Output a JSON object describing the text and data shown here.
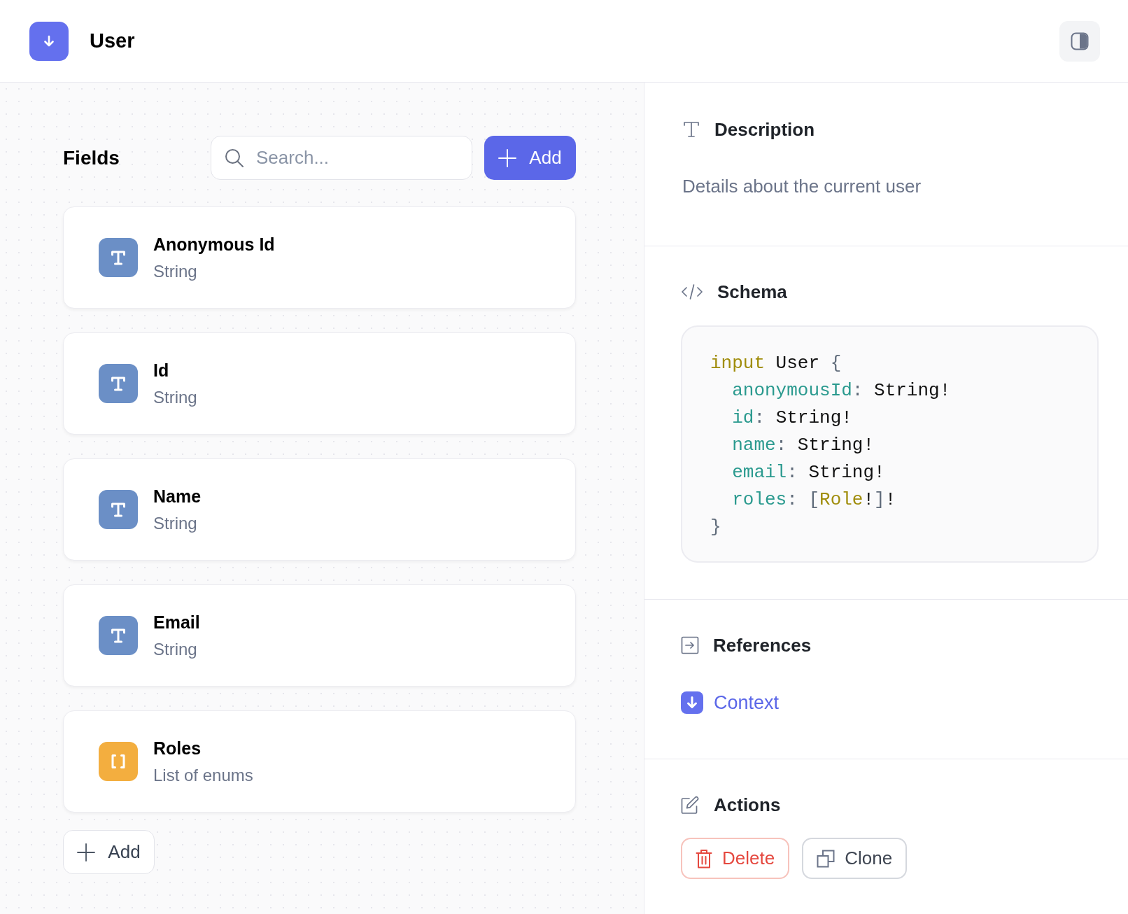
{
  "header": {
    "title": "User"
  },
  "fields_panel": {
    "title": "Fields",
    "search": {
      "placeholder": "Search..."
    },
    "add_button": "Add",
    "fields": [
      {
        "name": "Anonymous Id",
        "type": "String",
        "kind": "text"
      },
      {
        "name": "Id",
        "type": "String",
        "kind": "text"
      },
      {
        "name": "Name",
        "type": "String",
        "kind": "text"
      },
      {
        "name": "Email",
        "type": "String",
        "kind": "text"
      },
      {
        "name": "Roles",
        "type": "List of enums",
        "kind": "list"
      }
    ],
    "bottom_add_button": "Add"
  },
  "description": {
    "title": "Description",
    "text": "Details about the current user"
  },
  "schema": {
    "title": "Schema",
    "code": {
      "opening": [
        {
          "text": "input",
          "kind": "keyword"
        },
        {
          "text": " User ",
          "kind": "plain"
        },
        {
          "text": "{",
          "kind": "punct"
        }
      ],
      "children": [
        {
          "tokens": [
            {
              "text": "anonymousId",
              "kind": "field"
            },
            {
              "text": ":",
              "kind": "punct"
            },
            {
              "text": " String!",
              "kind": "plain"
            }
          ]
        },
        {
          "tokens": [
            {
              "text": "id",
              "kind": "field"
            },
            {
              "text": ":",
              "kind": "punct"
            },
            {
              "text": " String!",
              "kind": "plain"
            }
          ]
        },
        {
          "tokens": [
            {
              "text": "name",
              "kind": "field"
            },
            {
              "text": ":",
              "kind": "punct"
            },
            {
              "text": " String!",
              "kind": "plain"
            }
          ]
        },
        {
          "tokens": [
            {
              "text": "email",
              "kind": "field"
            },
            {
              "text": ":",
              "kind": "punct"
            },
            {
              "text": " String!",
              "kind": "plain"
            }
          ]
        },
        {
          "tokens": [
            {
              "text": "roles",
              "kind": "field"
            },
            {
              "text": ": [",
              "kind": "punct"
            },
            {
              "text": "Role",
              "kind": "keyword"
            },
            {
              "text": "!",
              "kind": "plain"
            },
            {
              "text": "]",
              "kind": "punct"
            },
            {
              "text": "!",
              "kind": "plain"
            }
          ]
        }
      ],
      "closing": [
        {
          "text": "}",
          "kind": "punct"
        }
      ]
    }
  },
  "references": {
    "title": "References",
    "items": [
      {
        "label": "Context"
      }
    ]
  },
  "actions": {
    "title": "Actions",
    "buttons": [
      {
        "label": "Delete",
        "kind": "danger"
      },
      {
        "label": "Clone",
        "kind": "copy"
      }
    ]
  }
}
